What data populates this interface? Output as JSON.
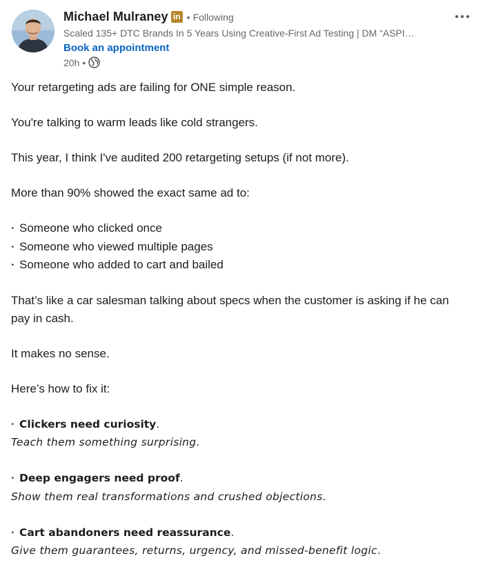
{
  "author": {
    "name": "Michael Mulraney",
    "badge": "in",
    "separator": "•",
    "follow_status": "Following",
    "headline": "Scaled 135+ DTC Brands In 5 Years Using Creative-First Ad Testing | DM “ASPI…",
    "cta": "Book an appointment",
    "time": "20h",
    "time_separator": "•",
    "visibility_icon": "globe-icon"
  },
  "menu": {
    "icon": "more-horizontal-icon"
  },
  "colors": {
    "link": "#0a66c2",
    "badge": "#b7862b",
    "muted": "#666666",
    "text": "#1d1d1d"
  },
  "post": {
    "p1": "Your retargeting ads are failing for ONE simple reason.",
    "p2": "You're talking to warm leads like cold strangers.",
    "p3": "This year, I think I've audited 200 retargeting setups (if not more).",
    "p4": "More than 90% showed the exact same ad to:",
    "bullet_marker": "‣",
    "bullets": [
      "Someone who clicked once",
      "Someone who viewed multiple pages",
      "Someone who added to cart and bailed"
    ],
    "p5_line1": "That’s like a car salesman talking about specs when the customer is asking if he can",
    "p5_line2": "pay in cash.",
    "p6": "It makes no sense.",
    "p7": "Here’s how to fix it:",
    "fixes": [
      {
        "head": "Clickers need curiosity",
        "tail": ".",
        "detail": "Teach them something surprising",
        "detail_tail": "."
      },
      {
        "head": "Deep engagers need proof",
        "tail": ".",
        "detail": "Show them real transformations and crushed objections",
        "detail_tail": "."
      },
      {
        "head": "Cart abandoners need reassurance",
        "tail": ".",
        "detail": "Give them guarantees, returns, urgency, and missed-benefit logic",
        "detail_tail": "."
      }
    ]
  }
}
